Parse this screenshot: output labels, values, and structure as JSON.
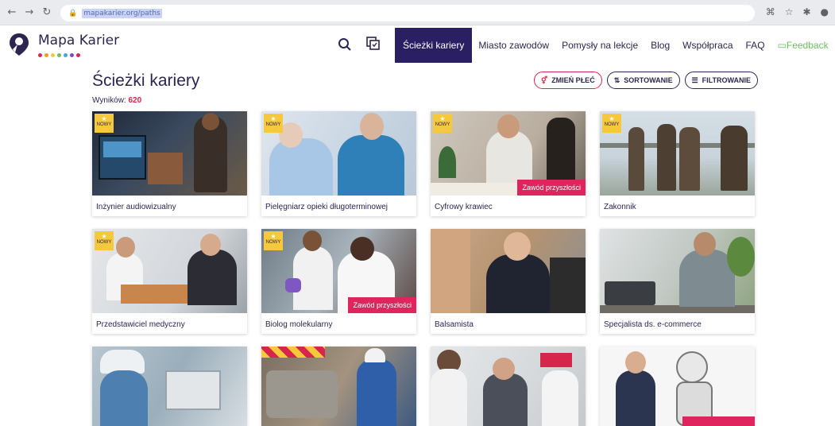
{
  "browser": {
    "url": "mapakarier.org/paths"
  },
  "header": {
    "logo_text": "Mapa Karier",
    "logo_dot_colors": [
      "#e0245e",
      "#f39c12",
      "#f6c83b",
      "#6abf5d",
      "#3aa8d8",
      "#7b4bc4",
      "#d8254b"
    ],
    "menu": [
      {
        "label": "Ścieżki kariery",
        "active": true
      },
      {
        "label": "Miasto zawodów",
        "active": false
      },
      {
        "label": "Pomysły na lekcje",
        "active": false
      },
      {
        "label": "Blog",
        "active": false
      },
      {
        "label": "Współpraca",
        "active": false
      },
      {
        "label": "FAQ",
        "active": false
      },
      {
        "label": "Feedback",
        "active": false
      }
    ]
  },
  "main": {
    "title": "Ścieżki kariery",
    "results_label": "Wyników:",
    "results_count": "620",
    "buttons": {
      "gender": "ZMIEŃ PŁEĆ",
      "sort": "SORTOWANIE",
      "filter": "FILTROWANIE"
    },
    "badge_new": "NOWY",
    "badge_future": "Zawód przyszłości",
    "cards": [
      {
        "title": "Inżynier audiowizualny",
        "new": true,
        "future": false
      },
      {
        "title": "Pielęgniarz opieki długoterminowej",
        "new": true,
        "future": false
      },
      {
        "title": "Cyfrowy krawiec",
        "new": true,
        "future": true
      },
      {
        "title": "Zakonnik",
        "new": true,
        "future": false
      },
      {
        "title": "Przedstawiciel medyczny",
        "new": true,
        "future": false
      },
      {
        "title": "Biolog molekularny",
        "new": true,
        "future": true
      },
      {
        "title": "Balsamista",
        "new": false,
        "future": false
      },
      {
        "title": "Specjalista ds. e-commerce",
        "new": false,
        "future": false
      }
    ]
  },
  "colors": {
    "brand_navy": "#2b1f63",
    "accent_pink": "#e0245e",
    "badge_yellow": "#f6c83b",
    "feedback_green": "#6abf5d"
  }
}
